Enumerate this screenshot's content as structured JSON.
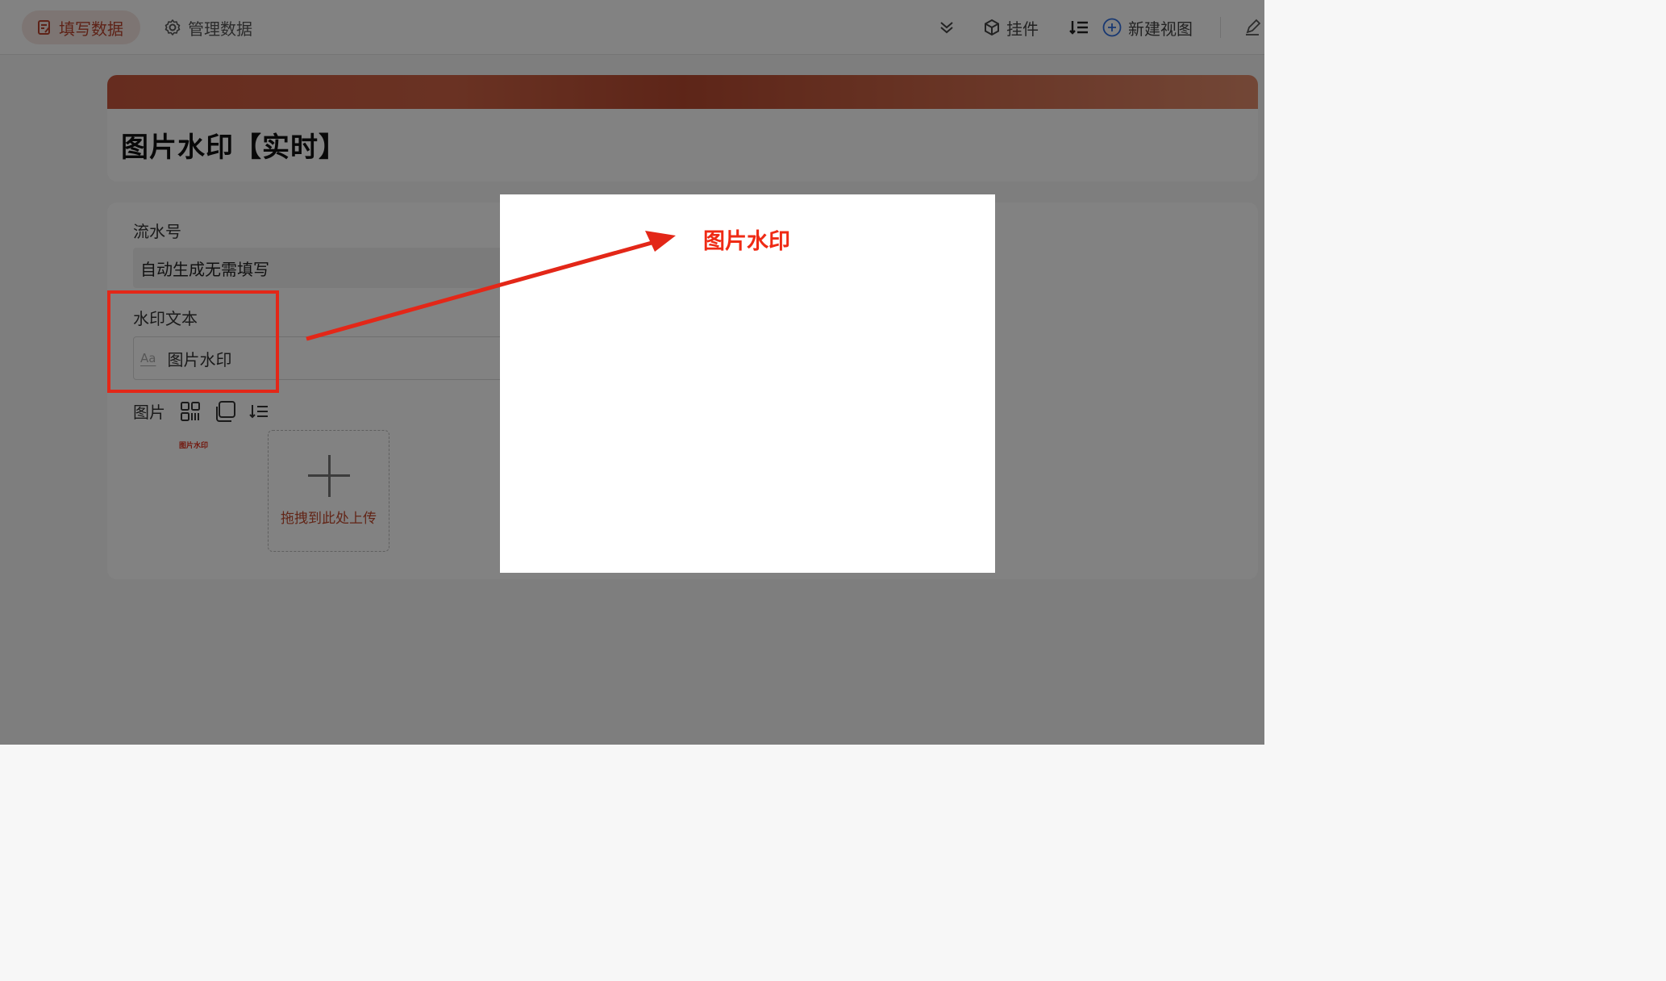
{
  "topbar": {
    "tab_fill": "填写数据",
    "tab_manage": "管理数据",
    "widgets": "挂件",
    "new_view": "新建视图"
  },
  "form": {
    "title": "图片水印【实时】",
    "serial_label": "流水号",
    "serial_value": "自动生成无需填写",
    "watermark_label": "水印文本",
    "watermark_type_hint": "Aa",
    "watermark_value": "图片水印",
    "image_label": "图片",
    "thumb_text": "图片水印",
    "upload_text": "拖拽到此处上传"
  },
  "preview": {
    "watermark_text": "图片水印"
  },
  "colors": {
    "accent": "#b8442d",
    "annotation_red": "#e32718",
    "watermark_red": "#ef2a14"
  }
}
